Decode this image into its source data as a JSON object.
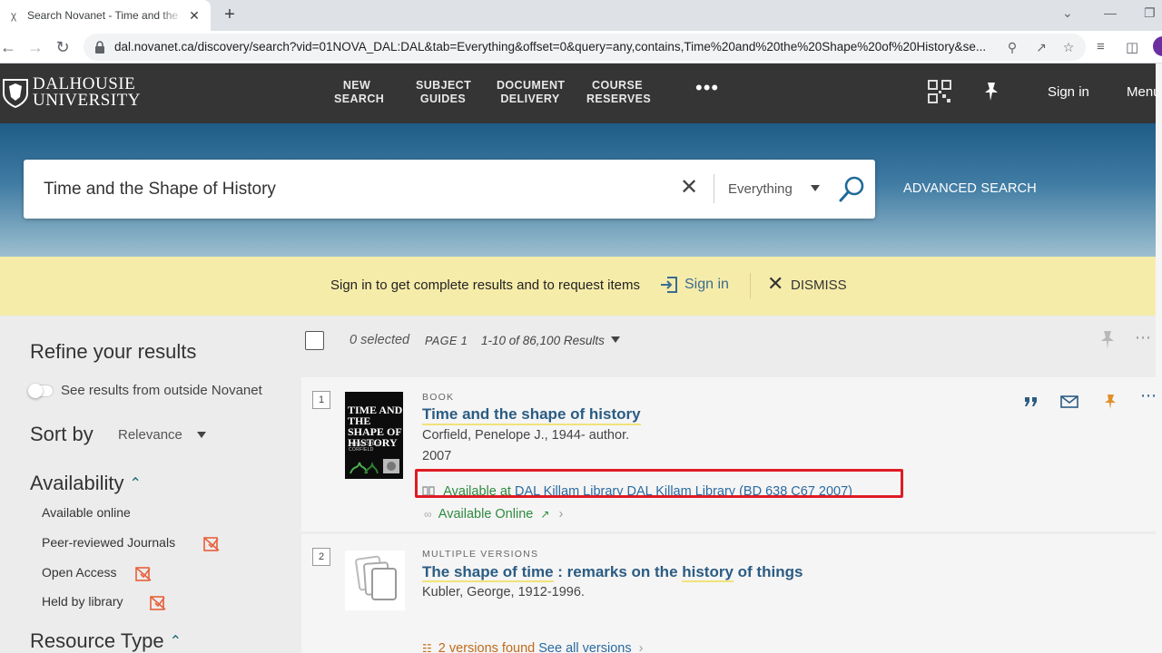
{
  "browser": {
    "tab_title": "Search Novanet - Time and the Shape of History",
    "url": "dal.novanet.ca/discovery/search?vid=01NOVA_DAL:DAL&tab=Everything&offset=0&query=any,contains,Time%20and%20the%20Shape%20of%20History&se..."
  },
  "header": {
    "logo_line1": "DALHOUSIE",
    "logo_line2": "UNIVERSITY",
    "nav": [
      {
        "line1": "NEW",
        "line2": "SEARCH"
      },
      {
        "line1": "SUBJECT",
        "line2": "GUIDES"
      },
      {
        "line1": "DOCUMENT",
        "line2": "DELIVERY"
      },
      {
        "line1": "COURSE",
        "line2": "RESERVES"
      }
    ],
    "more": "•••",
    "sign_in": "Sign in",
    "menu": "Menu"
  },
  "search": {
    "query": "Time and the Shape of History",
    "scope": "Everything",
    "advanced": "ADVANCED SEARCH"
  },
  "banner": {
    "text": "Sign in to get complete results and to request items",
    "sign_in": "Sign in",
    "dismiss": "DISMISS"
  },
  "facets": {
    "refine_title": "Refine your results",
    "outside_toggle": "See results from outside Novanet",
    "sort_label": "Sort by",
    "sort_value": "Relevance",
    "availability_heading": "Availability",
    "availability_items": [
      "Available online",
      "Peer-reviewed Journals",
      "Open Access",
      "Held by library"
    ],
    "resource_heading": "Resource Type"
  },
  "results_bar": {
    "selected": "0 selected",
    "page": "PAGE 1",
    "count": "1-10 of 86,100 Results"
  },
  "results": [
    {
      "rank": "1",
      "type": "BOOK",
      "title": "Time and the shape of history",
      "creator": "Corfield, Penelope J., 1944- author.",
      "year": "2007",
      "avail_prefix": "Available at",
      "avail_location": "DAL Killam Library  DAL Killam Library (BD 638 C67 2007)",
      "online": "Available Online",
      "cover_title": "TIME AND THE SHAPE OF HISTORY",
      "cover_author": "PENELOPE J. CORFIELD"
    },
    {
      "rank": "2",
      "type": "MULTIPLE VERSIONS",
      "title_part1": "The shape of time",
      "title_part2": " : remarks on the ",
      "title_part3": "history",
      "title_part4": " of things",
      "creator": "Kubler, George, 1912-1996.",
      "versions": "2 versions found",
      "see_all": "See all versions"
    }
  ],
  "colors": {
    "header_bg": "#353535",
    "banner_bg": "#f6ecaa",
    "link_blue": "#2b5c83",
    "available_green": "#2e8b3f",
    "highlight_red": "#e01b24"
  }
}
